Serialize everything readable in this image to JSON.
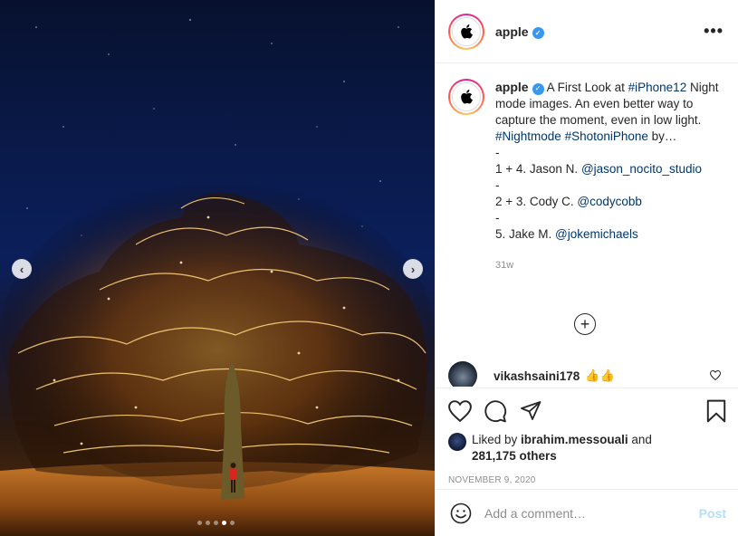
{
  "media": {
    "carousel": {
      "slide_count": 5,
      "active_index": 3
    },
    "prev_glyph": "‹",
    "next_glyph": "›"
  },
  "header": {
    "username": "apple",
    "verified_glyph": "✓",
    "more_glyph": "•••"
  },
  "caption": {
    "username": "apple",
    "lines": [
      {
        "text": "A First Look at "
      },
      {
        "tag": "#iPhone12"
      },
      {
        "text": " Night mode images. An even better way to capture the moment, even in low light. "
      },
      {
        "tag": "#Nightmode"
      },
      {
        "text": " "
      },
      {
        "tag": "#ShotoniPhone"
      },
      {
        "text": " by…"
      }
    ],
    "credits": [
      {
        "dash": "-",
        "label": "1 + 4. Jason N. ",
        "handle": "@jason_nocito_studio"
      },
      {
        "dash": "-",
        "label": "2 + 3. Cody C. ",
        "handle": "@codycobb"
      },
      {
        "dash": "-",
        "label": "5. Jake M. ",
        "handle": "@jokemichaels"
      }
    ],
    "age": "31w"
  },
  "load_more_glyph": "+",
  "comment": {
    "username": "vikashsaini178",
    "text": "👍👍"
  },
  "likes": {
    "prefix": "Liked by ",
    "user": "ibrahim.messouali",
    "mid": " and",
    "count": "281,175 others"
  },
  "date": "NOVEMBER 9, 2020",
  "add_comment": {
    "placeholder": "Add a comment…",
    "post_label": "Post"
  },
  "icons": [
    "apple-logo-icon",
    "verified-badge-icon",
    "more-options-icon",
    "heart-icon",
    "comment-icon",
    "share-icon",
    "bookmark-icon",
    "emoji-icon",
    "plus-circle-icon",
    "chevron-left-icon",
    "chevron-right-icon"
  ],
  "colors": {
    "link": "#00376b",
    "verified": "#3897f0",
    "post_disabled": "#b2dffc",
    "muted": "#8e8e8e"
  }
}
